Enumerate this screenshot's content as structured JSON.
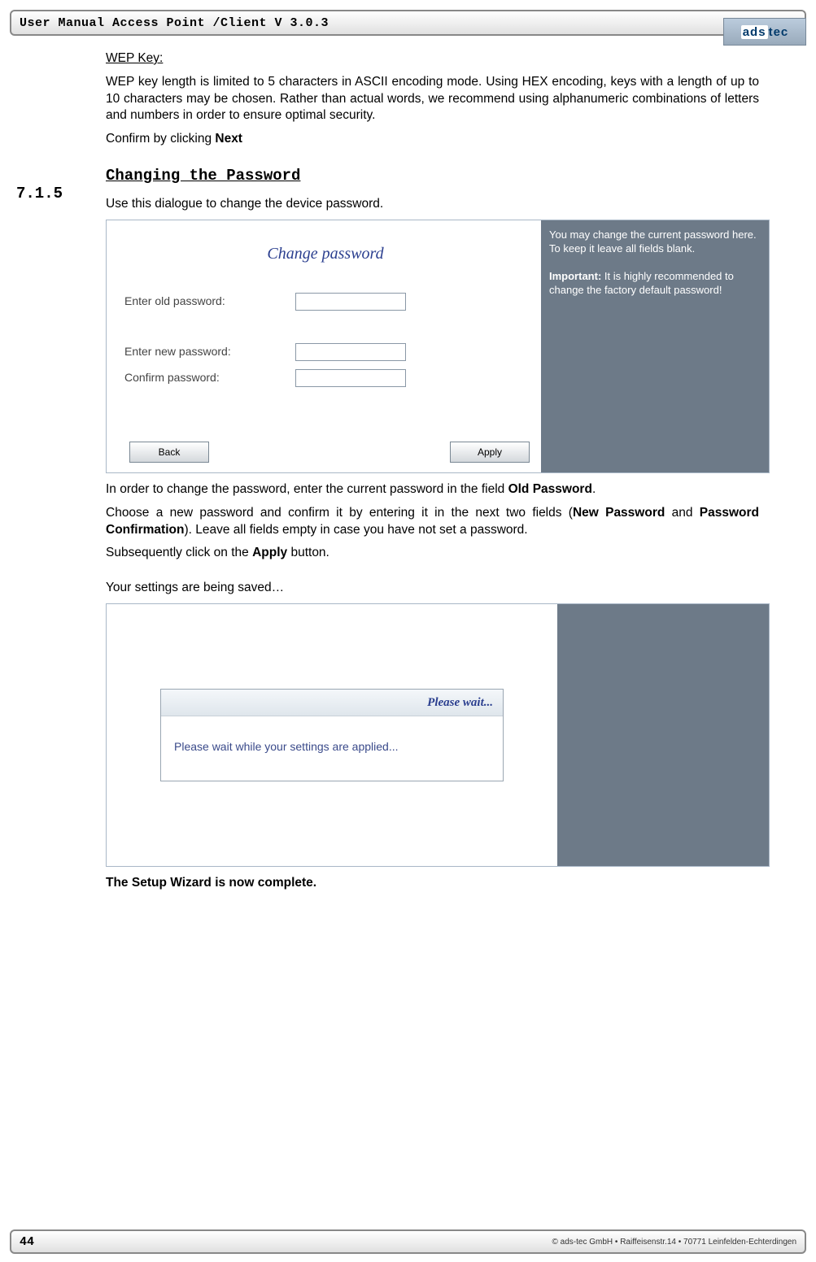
{
  "header": {
    "title": "User Manual Access Point /Client V 3.0.3",
    "logo": "ads tec"
  },
  "wep": {
    "heading": "WEP Key:",
    "body": "WEP key length is limited to 5 characters in ASCII encoding mode. Using HEX encoding, keys with a length of up to 10 characters may be chosen. Rather than actual words, we recommend using alphanumeric combinations of letters and numbers in order to ensure optimal security.",
    "confirm_prefix": "Confirm by clicking ",
    "confirm_button": "Next"
  },
  "section": {
    "number": "7.1.5",
    "title": "Changing the Password",
    "intro": "Use this dialogue to change the device password."
  },
  "dialog1": {
    "title": "Change password",
    "old_label": "Enter old password:",
    "new_label": "Enter new password:",
    "confirm_label": "Confirm password:",
    "back": "Back",
    "apply": "Apply",
    "side_line1": "You may change the current password here. To keep it leave all fields blank.",
    "side_imp_label": "Important:",
    "side_imp_text": " It is highly recommended to change the factory default password!"
  },
  "after1": {
    "p1_a": "In order to change the password, enter the current password in the field ",
    "p1_b": "Old Password",
    "p1_c": ".",
    "p2_a": "Choose a new password and confirm it by entering it in the next two fields (",
    "p2_b": "New Password",
    "p2_c": " and ",
    "p2_d": "Password Confirmation",
    "p2_e": "). Leave all fields empty in case you have not set a password.",
    "p3_a": "Subsequently click on the ",
    "p3_b": "Apply",
    "p3_c": " button.",
    "p4": "Your settings are being saved…"
  },
  "dialog2": {
    "title": "Please wait...",
    "body": "Please wait while your settings are applied..."
  },
  "final": "The Setup Wizard is now complete.",
  "footer": {
    "page": "44",
    "copy": "© ads-tec GmbH • Raiffeisenstr.14 • 70771 Leinfelden-Echterdingen"
  }
}
